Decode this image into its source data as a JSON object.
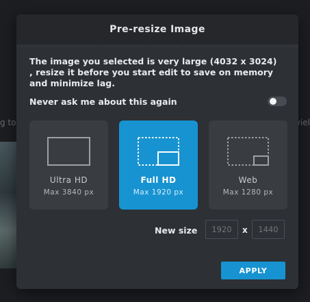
{
  "background": {
    "left_text": "g to",
    "right_text": "viel"
  },
  "dialog": {
    "title": "Pre-resize Image",
    "message": "The image you selected is very large (4032 x 3024) , resize it before you start edit to save on memory and minimize lag.",
    "never_ask_label": "Never ask me about this again",
    "never_ask_enabled": false,
    "options": [
      {
        "label": "Ultra HD",
        "sub": "Max 3840 px",
        "selected": false,
        "icon": "ultra-hd-frame-icon"
      },
      {
        "label": "Full HD",
        "sub": "Max 1920 px",
        "selected": true,
        "icon": "full-hd-frame-icon"
      },
      {
        "label": "Web",
        "sub": "Max 1280 px",
        "selected": false,
        "icon": "web-frame-icon"
      }
    ],
    "new_size": {
      "label": "New size",
      "width_placeholder": "1920",
      "separator": "x",
      "height_placeholder": "1440"
    },
    "apply_label": "APPLY"
  },
  "colors": {
    "accent": "#1793d1",
    "modal_bg": "#2d3035",
    "tile_bg": "#393c41"
  }
}
